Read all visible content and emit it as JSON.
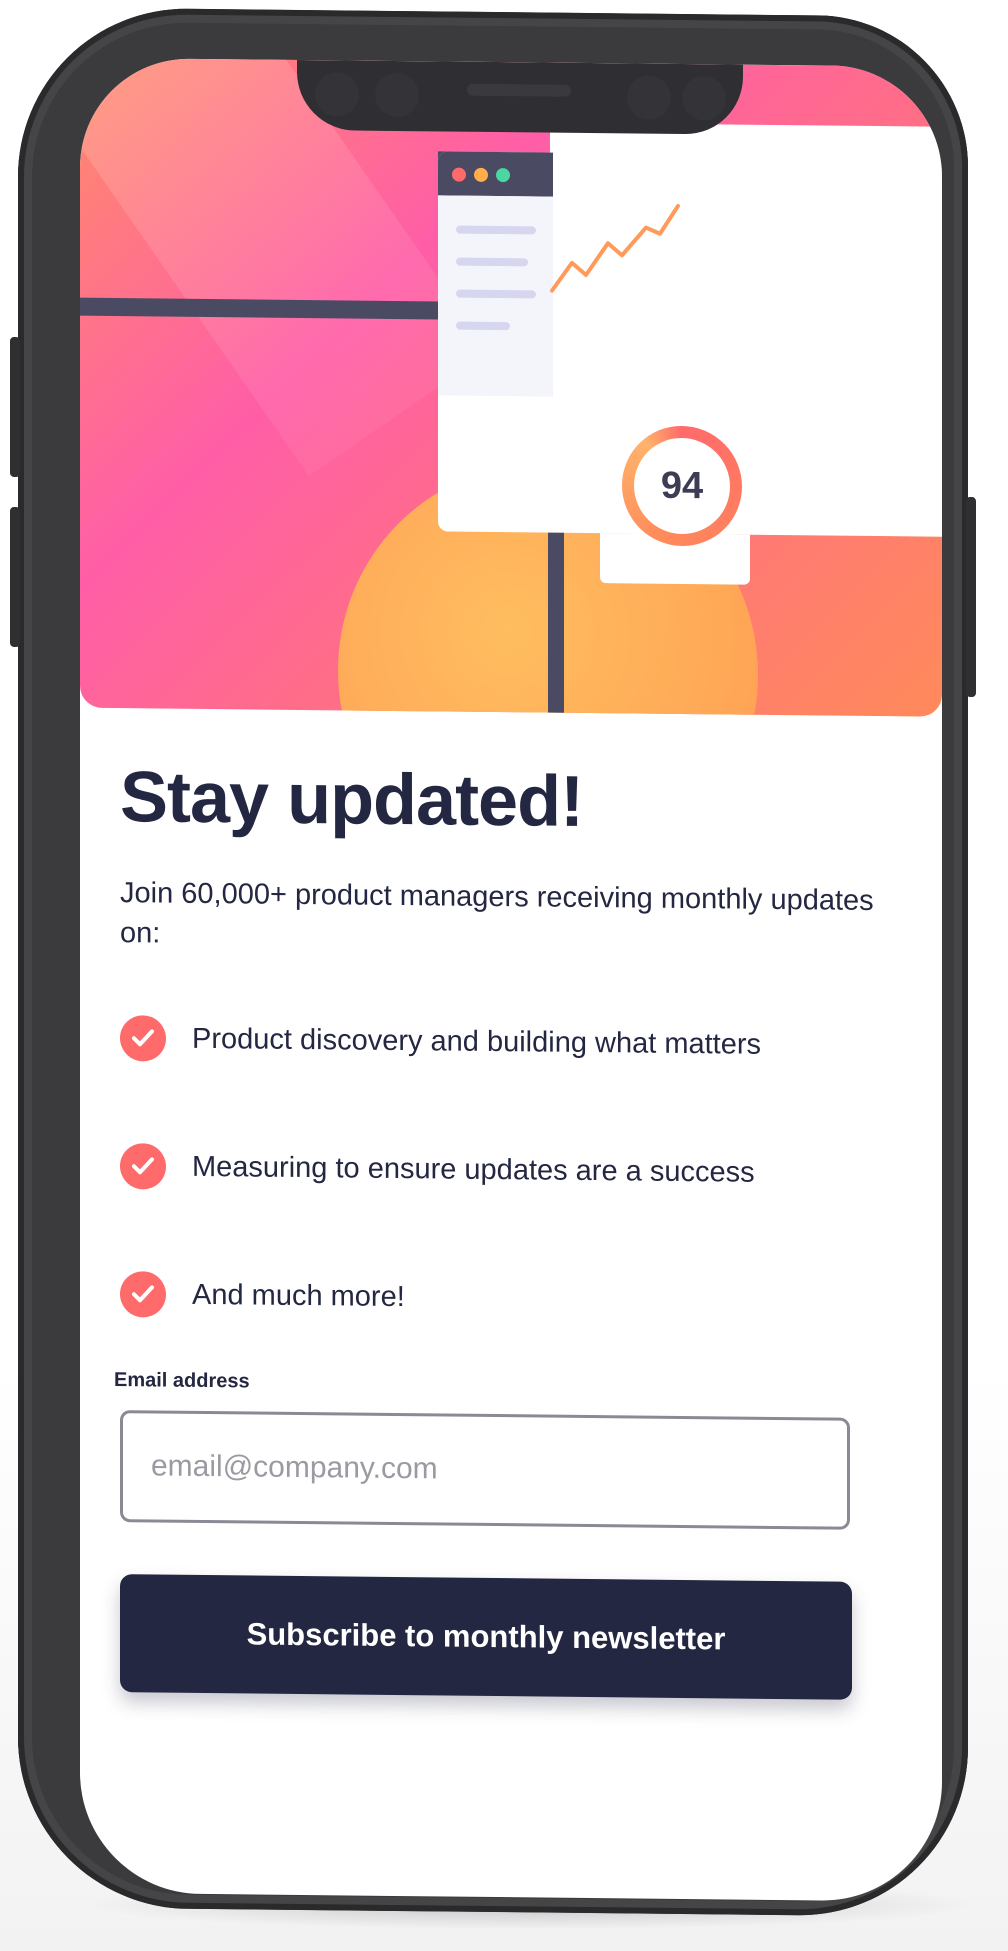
{
  "hero": {
    "score": "94",
    "window_dot_colors": [
      "#ff6a6a",
      "#ffae4a",
      "#4ad7a0"
    ],
    "icon": "dashboard-illustration"
  },
  "signup": {
    "title": "Stay updated!",
    "subtitle": "Join 60,000+ product managers receiving monthly updates on:",
    "features": [
      {
        "text": "Product discovery and building what matters",
        "icon": "check-icon"
      },
      {
        "text": "Measuring to ensure updates are a success",
        "icon": "check-icon"
      },
      {
        "text": "And much more!",
        "icon": "check-icon"
      }
    ],
    "email_label": "Email address",
    "email_placeholder": "email@company.com",
    "email_value": "",
    "subscribe_label": "Subscribe to monthly newsletter"
  },
  "colors": {
    "accent": "#ff6a6a",
    "dark": "#242742",
    "gradient_start": "#ff5ea7",
    "gradient_end": "#ff8a5a"
  }
}
